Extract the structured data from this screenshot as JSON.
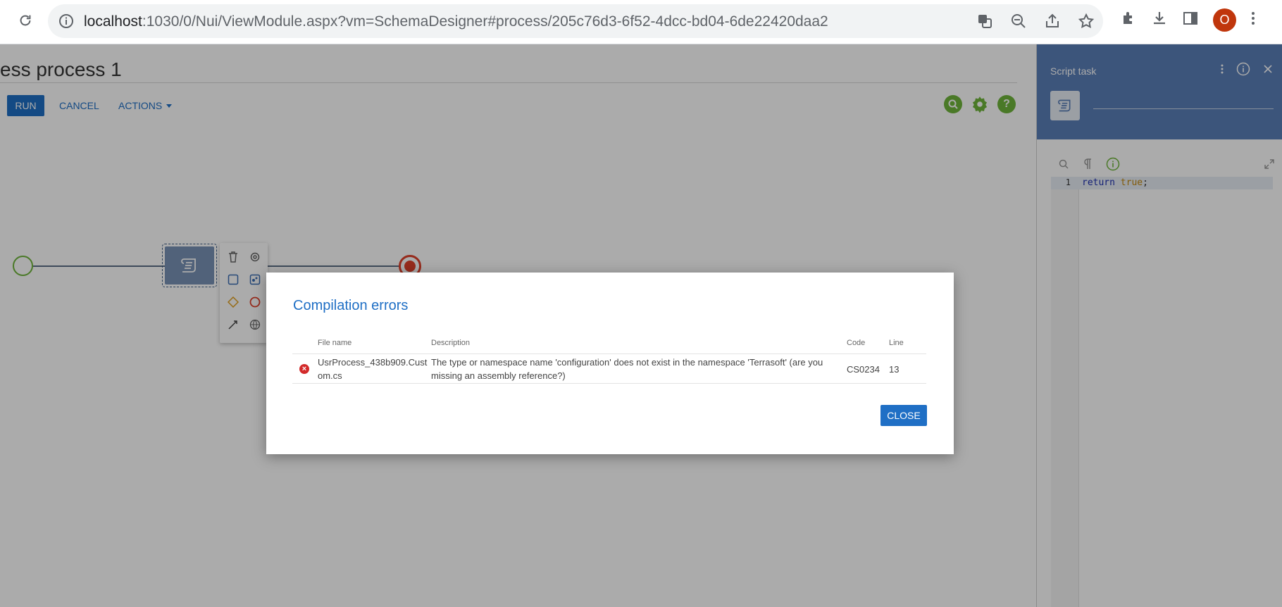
{
  "browser": {
    "url_host": "localhost",
    "url_path": ":1030/0/Nui/ViewModule.aspx?vm=SchemaDesigner#process/205c76d3-6f52-4dcc-bd04-6de22420daa2",
    "profile_initial": "O"
  },
  "designer": {
    "title": "ess process 1",
    "run_label": "RUN",
    "cancel_label": "CANCEL",
    "actions_label": "ACTIONS",
    "help_glyph": "?"
  },
  "panel": {
    "title": "Script task",
    "code_line_number": "1",
    "code_keyword": "return",
    "code_space": " ",
    "code_literal": "true",
    "code_end": ";"
  },
  "modal": {
    "title": "Compilation errors",
    "columns": {
      "file": "File name",
      "description": "Description",
      "code": "Code",
      "line": "Line"
    },
    "rows": [
      {
        "file": "UsrProcess_438b909.Custom.cs",
        "description": "The type or namespace name 'configuration' does not exist in the namespace 'Terrasoft' (are you missing an assembly reference?)",
        "code": "CS0234",
        "line": "13"
      }
    ],
    "close_label": "CLOSE"
  },
  "colors": {
    "accent": "#1f6fc5",
    "panel_header": "#5a7fb8",
    "error": "#d32a2a",
    "start_event": "#6fb53b",
    "end_event": "#e0402a"
  },
  "icons": [
    "reload-icon",
    "info-icon",
    "translate-icon",
    "zoom-out-icon",
    "share-icon",
    "star-icon",
    "extensions-icon",
    "download-icon",
    "side-panel-icon",
    "menu-icon",
    "search-icon",
    "settings-icon",
    "help-icon",
    "script-task-icon",
    "delete-icon",
    "gear-icon",
    "task-shape-icon",
    "subprocess-icon",
    "gateway-icon",
    "end-event-icon",
    "connector-icon",
    "web-service-icon",
    "pilcrow-icon",
    "expand-icon",
    "error-icon",
    "close-icon",
    "more-icon"
  ]
}
